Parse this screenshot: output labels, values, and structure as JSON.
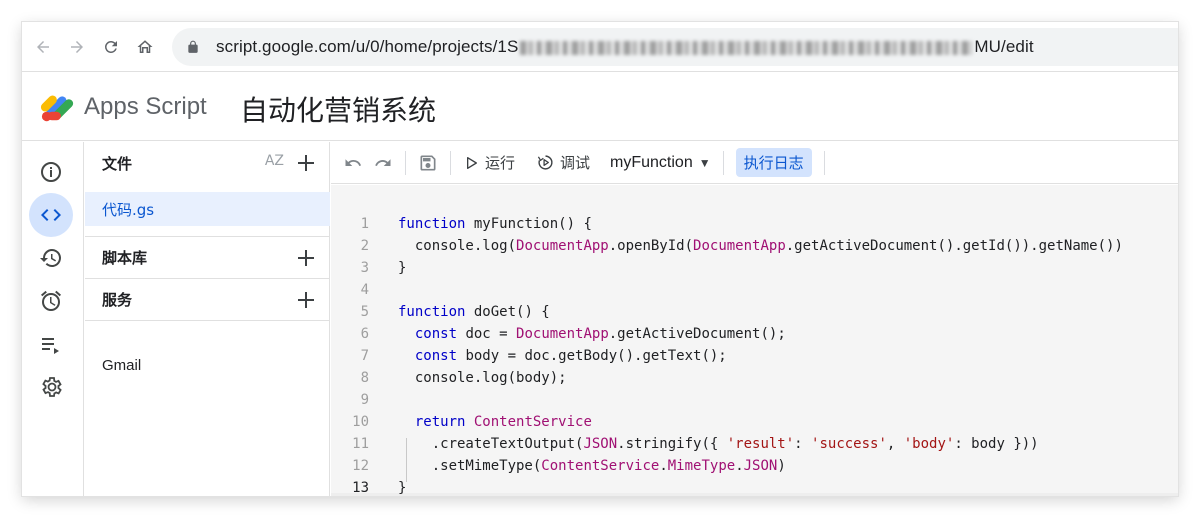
{
  "browser": {
    "url_host": "script.google.com/u/0/home/projects/1S",
    "url_suffix": "MU/edit"
  },
  "app": {
    "name": "Apps Script",
    "project_title": "自动化营销系统"
  },
  "sidebar": {
    "files_label": "文件",
    "sort_label": "AZ",
    "files": [
      {
        "name": "代码.gs"
      }
    ],
    "libraries_label": "脚本库",
    "services_label": "服务",
    "services": [
      {
        "name": "Gmail"
      }
    ]
  },
  "toolbar": {
    "run_label": "运行",
    "debug_label": "调试",
    "function_select": "myFunction",
    "exec_log_label": "执行日志"
  },
  "editor": {
    "current_line": 13,
    "lines": [
      "function myFunction() {",
      "  console.log(DocumentApp.openById(DocumentApp.getActiveDocument().getId()).getName())",
      "}",
      "",
      "function doGet() {",
      "  const doc = DocumentApp.getActiveDocument();",
      "  const body = doc.getBody().getText();",
      "  console.log(body);",
      "",
      "  return ContentService",
      "    .createTextOutput(JSON.stringify({ 'result': 'success', 'body': body }))",
      "    .setMimeType(ContentService.MimeType.JSON)",
      "}"
    ]
  },
  "colors": {
    "keyword": "#0000c8",
    "class": "#a01073",
    "string": "#a31515",
    "accent": "#0b57d0",
    "active_bg": "#d3e3fd"
  }
}
